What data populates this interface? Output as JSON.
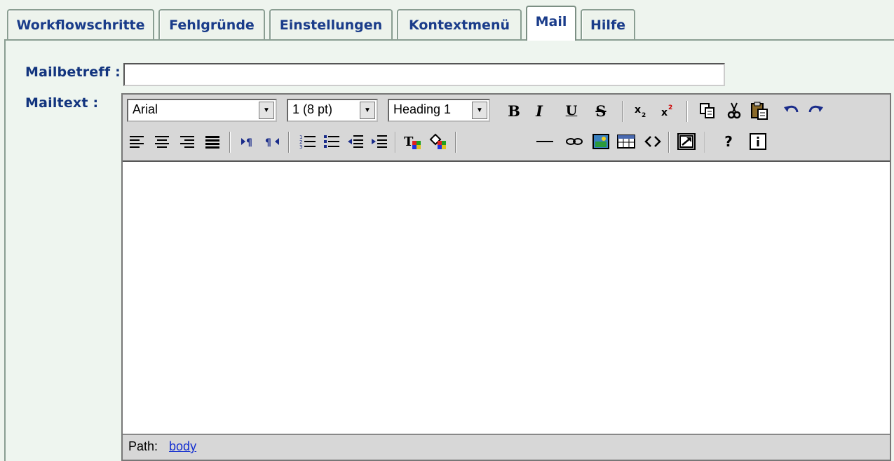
{
  "tabs": [
    {
      "label": "Workflowschritte",
      "active": false
    },
    {
      "label": "Fehlgründe",
      "active": false
    },
    {
      "label": "Einstellungen",
      "active": false
    },
    {
      "label": "Kontextmenü",
      "active": false
    },
    {
      "label": "Mail",
      "active": true
    },
    {
      "label": "Hilfe",
      "active": false
    }
  ],
  "form": {
    "subject_label": "Mailbetreff :",
    "subject_value": "",
    "body_label": "Mailtext :"
  },
  "editor": {
    "font_select": "Arial",
    "size_select": "1 (8 pt)",
    "format_select": "Heading 1",
    "bold_label": "B",
    "italic_label": "I",
    "underline_label": "U",
    "strike_label": "S",
    "help_label": "?",
    "status_path_label": "Path:",
    "status_path_link": "body"
  }
}
